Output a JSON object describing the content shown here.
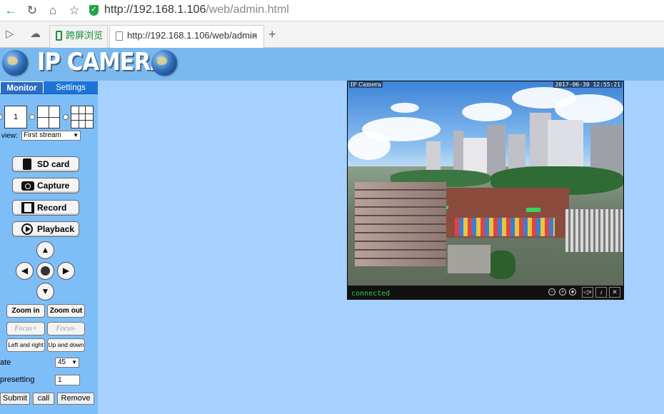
{
  "browser": {
    "url_host": "http://192.168.1.106",
    "url_path": "/web/admin.html",
    "tabs": [
      {
        "label": "跨屏浏览"
      },
      {
        "label": "http://192.168.1.106/web/admin"
      }
    ],
    "new_tab_label": "+",
    "close_label": "×"
  },
  "header": {
    "logo_text": "IP CAMERA"
  },
  "left_panel": {
    "tabs": [
      {
        "label": "Monitor"
      },
      {
        "label": "Settings"
      }
    ],
    "layout_single_label": "1",
    "view_label": "view:",
    "view_value": "First stream",
    "buttons": {
      "sd_card": "SD card",
      "capture": "Capture",
      "record": "Record",
      "playback": "Playback"
    },
    "ptz": {
      "up": "▲",
      "down": "▼",
      "left": "◀",
      "right": "▶"
    },
    "zoom_in": "Zoom in",
    "zoom_out": "Zoom out",
    "focus_plus": "Focus+",
    "focus_minus": "Focus-",
    "left_and_right": "Left and right",
    "up_and_down": "Up and down",
    "rate_label": "ate",
    "rate_value": "45",
    "presetting_label": "presetting",
    "presetting_value": "1",
    "submit": "Submit",
    "call": "call",
    "remove": "Remove"
  },
  "video": {
    "label": "IP Camera",
    "timestamp": "2017-06-30 12:55:21",
    "status": "connected"
  }
}
